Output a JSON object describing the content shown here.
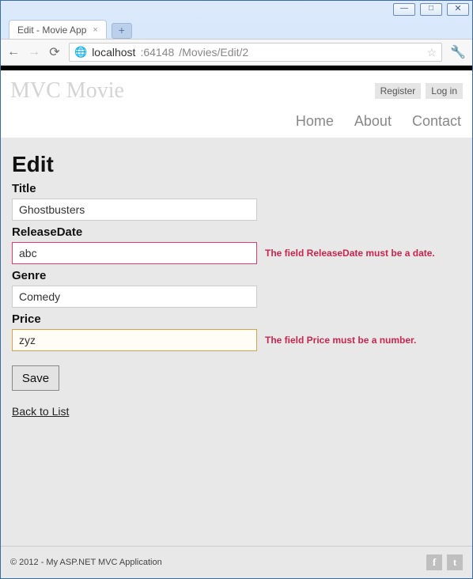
{
  "window": {
    "tab_title": "Edit - Movie App",
    "address_host": "localhost",
    "address_port": ":64148",
    "address_path": "/Movies/Edit/2"
  },
  "header": {
    "brand": "MVC Movie",
    "register": "Register",
    "login": "Log in"
  },
  "nav": {
    "home": "Home",
    "about": "About",
    "contact": "Contact"
  },
  "page": {
    "heading": "Edit",
    "fields": {
      "title": {
        "label": "Title",
        "value": "Ghostbusters"
      },
      "releaseDate": {
        "label": "ReleaseDate",
        "value": "abc",
        "error": "The field ReleaseDate must be a date."
      },
      "genre": {
        "label": "Genre",
        "value": "Comedy"
      },
      "price": {
        "label": "Price",
        "value": "zyz",
        "error": "The field Price must be a number."
      }
    },
    "save": "Save",
    "back": "Back to List"
  },
  "footer": {
    "copyright": "© 2012 - My ASP.NET MVC Application"
  }
}
